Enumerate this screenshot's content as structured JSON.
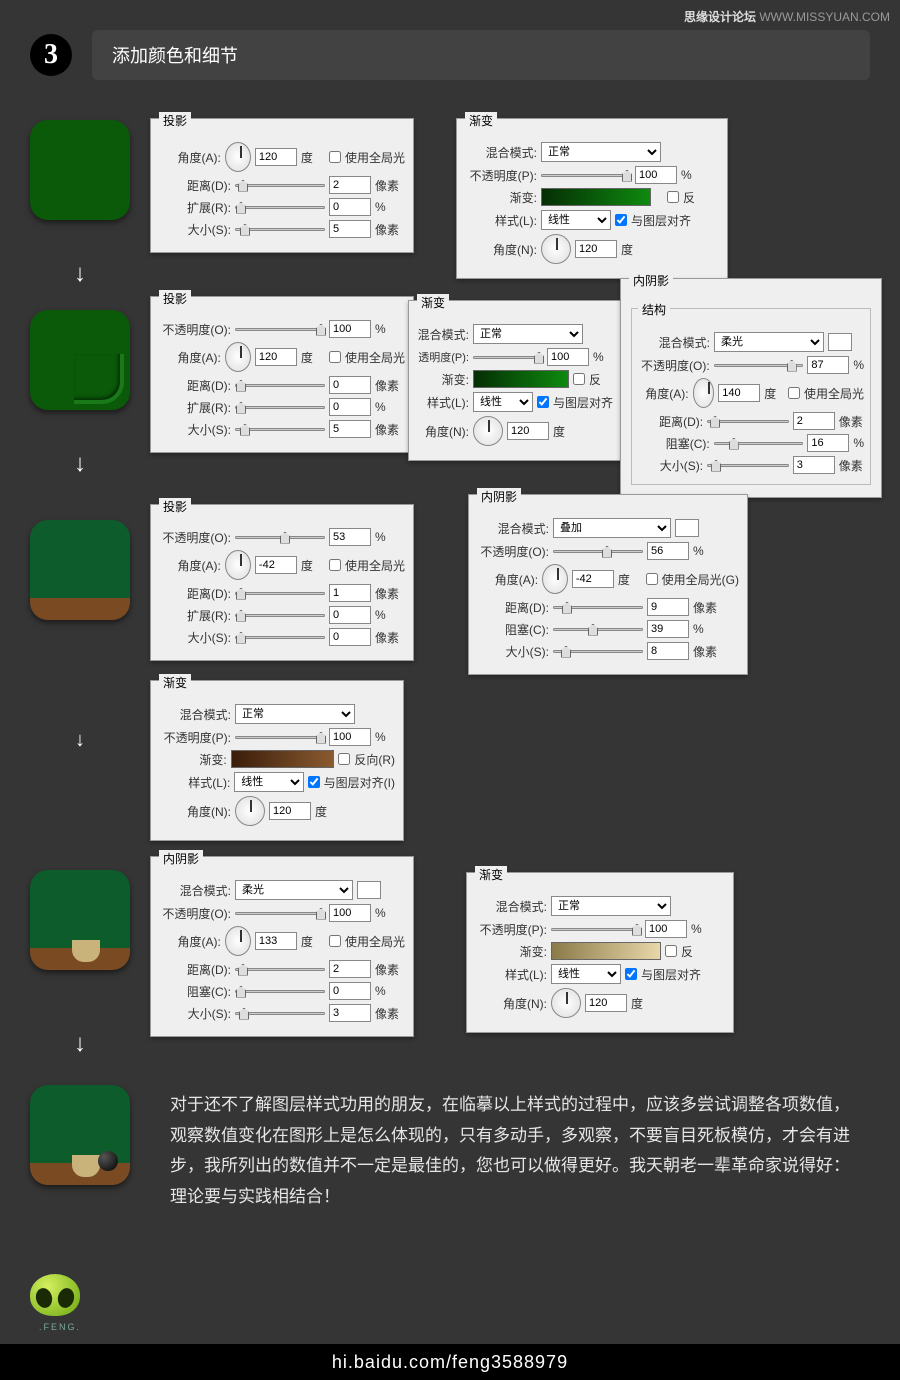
{
  "watermark_bold": "思缘设计论坛",
  "watermark_url": "WWW.MISSYUAN.COM",
  "step_number": "3",
  "step_title": "添加颜色和细节",
  "labels": {
    "dropshadow": "投影",
    "gradient": "渐变",
    "innershadow": "内阴影",
    "structure": "结构",
    "blend": "混合模式:",
    "opacity_o": "不透明度(O):",
    "opacity_p": "不透明度(P):",
    "angle_a": "角度(A):",
    "angle_n": "角度(N):",
    "distance": "距离(D):",
    "spread": "扩展(R):",
    "choke": "阻塞(C):",
    "size": "大小(S):",
    "grad": "渐变:",
    "style_l": "样式(L):",
    "deg": "度",
    "px": "像素",
    "pct": "%",
    "global": "使用全局光",
    "global_g": "使用全局光(G)",
    "align": "与图层对齐",
    "align_i": "与图层对齐(I)",
    "reverse": "反",
    "reverse_r": "反向(R)"
  },
  "select": {
    "normal": "正常",
    "linear": "线性",
    "softlight": "柔光",
    "overlay": "叠加"
  },
  "p1": {
    "angle": "120",
    "dist": "2",
    "spread": "0",
    "size": "5"
  },
  "p2": {
    "opacity": "100",
    "angle": "120"
  },
  "p3": {
    "opacity": "100",
    "angle": "120",
    "dist": "0",
    "spread": "0",
    "size": "5"
  },
  "p4": {
    "opacity": "100",
    "angle": "120"
  },
  "p5": {
    "opacity": "87",
    "angle": "140",
    "dist": "2",
    "choke": "16",
    "size": "3"
  },
  "p6": {
    "opacity": "53",
    "angle": "-42",
    "dist": "1",
    "spread": "0",
    "size": "0"
  },
  "p7": {
    "opacity": "56",
    "angle": "-42",
    "dist": "9",
    "choke": "39",
    "size": "8"
  },
  "p8": {
    "opacity": "100",
    "angle": "120"
  },
  "p9": {
    "opacity": "100",
    "angle": "133",
    "dist": "2",
    "choke": "0",
    "size": "3"
  },
  "p10": {
    "opacity": "100",
    "angle": "120"
  },
  "body_text": "对于还不了解图层样式功用的朋友，在临摹以上样式的过程中，应该多尝试调整各项数值，观察数值变化在图形上是怎么体现的，只有多动手，多观察，不要盲目死板模仿，才会有进步，我所列出的数值并不一定是最佳的，您也可以做得更好。我天朝老一辈革命家说得好：理论要与实践相结合！",
  "footer": "hi.baidu.com/feng3588979",
  "alien_badge": ".FENG."
}
